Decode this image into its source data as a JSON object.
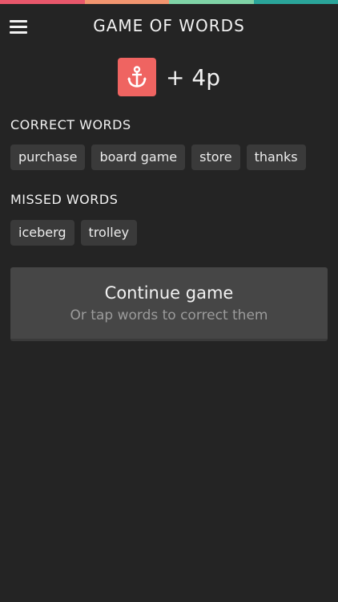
{
  "colors": {
    "strip": [
      "#e8576b",
      "#f2956f",
      "#7fd3a6",
      "#2aa59a"
    ],
    "badge": "#ef6461",
    "background": "#242424"
  },
  "header": {
    "title": "GAME OF WORDS",
    "menu_icon": "hamburger-menu-icon"
  },
  "score": {
    "icon": "anchor-icon",
    "points": "+ 4p"
  },
  "correct": {
    "label": "CORRECT WORDS",
    "words": [
      "purchase",
      "board game",
      "store",
      "thanks"
    ]
  },
  "missed": {
    "label": "MISSED WORDS",
    "words": [
      "iceberg",
      "trolley"
    ]
  },
  "continue": {
    "title": "Continue game",
    "subtitle": "Or tap words to correct them"
  }
}
